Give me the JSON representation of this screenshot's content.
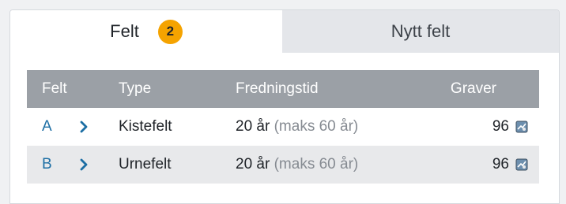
{
  "tabs": {
    "active_label": "Felt",
    "active_badge": "2",
    "inactive_label": "Nytt felt"
  },
  "table": {
    "headers": [
      "Felt",
      "Type",
      "Fredningstid",
      "Graver"
    ],
    "rows": [
      {
        "felt": "A",
        "type": "Kistefelt",
        "fredningstid": "20 år",
        "maks": "(maks 60 år)",
        "graver": "96"
      },
      {
        "felt": "B",
        "type": "Urnefelt",
        "fredningstid": "20 år",
        "maks": "(maks 60 år)",
        "graver": "96"
      }
    ]
  },
  "icons": {
    "row_expand": "chevron-right-icon",
    "graves": "grave-map-icon"
  },
  "colors": {
    "accent": "#1c6ea4",
    "badge": "#f5a300",
    "header_bg": "#9ba0a6"
  }
}
